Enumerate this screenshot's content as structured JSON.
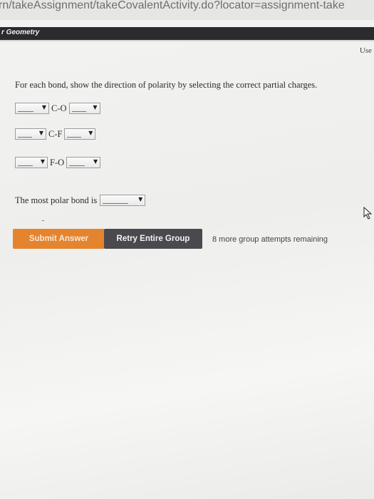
{
  "browser": {
    "url_text": "rn/takeAssignment/takeCovalentActivity.do?locator=assignment-take"
  },
  "header": {
    "topic": "r Geometry",
    "use_link": "Use"
  },
  "question": {
    "prompt": "For each bond, show the direction of polarity by selecting the correct partial charges.",
    "bonds": [
      {
        "label": "C-O",
        "left_value": "",
        "right_value": ""
      },
      {
        "label": "C-F",
        "left_value": "",
        "right_value": ""
      },
      {
        "label": "F-O",
        "left_value": "",
        "right_value": ""
      }
    ],
    "most_polar_label": "The most polar bond is",
    "most_polar_value": ""
  },
  "actions": {
    "submit_label": "Submit Answer",
    "retry_label": "Retry Entire Group",
    "attempts_text": "8 more group attempts remaining"
  },
  "colors": {
    "submit_bg": "#e5842e",
    "retry_bg": "#4a4a4e",
    "topic_bar_bg": "#2b2b2e"
  },
  "icons": {
    "dropdown_arrow": "triangle-down-icon",
    "cursor": "mouse-pointer-icon"
  }
}
